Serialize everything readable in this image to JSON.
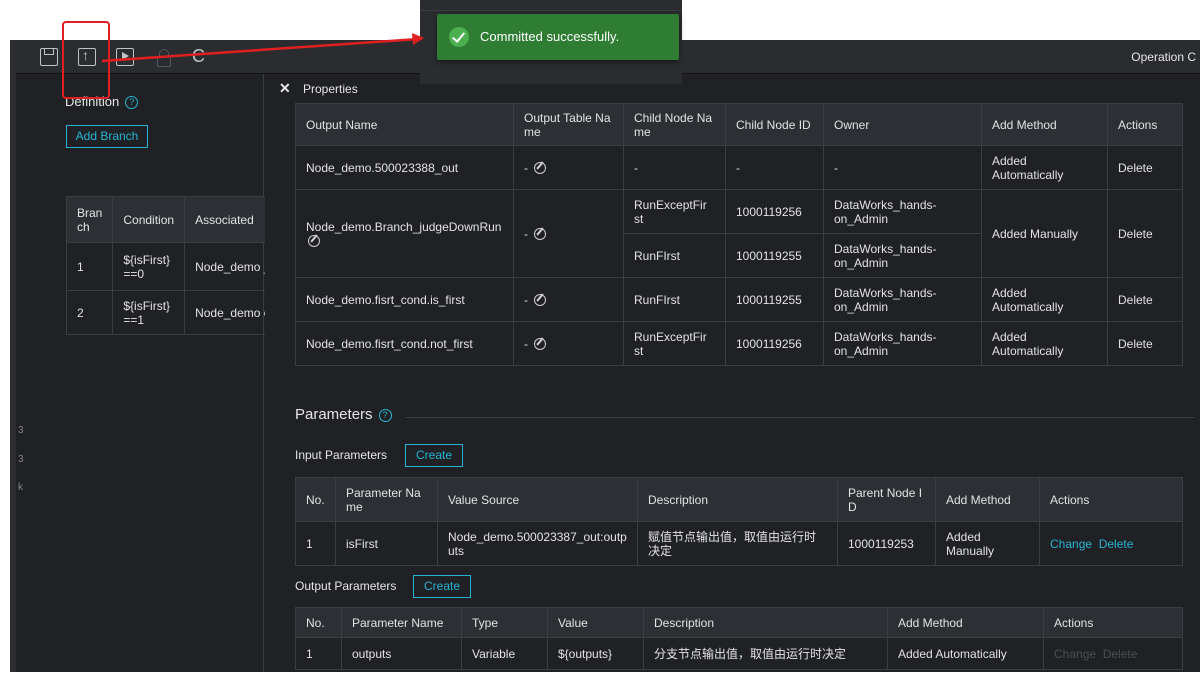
{
  "toolbar": {
    "icons": [
      "save-icon",
      "commit-icon",
      "run-icon",
      "lock-icon",
      "refresh-icon"
    ],
    "right_text": "Operation C"
  },
  "toast": {
    "message": "Committed successfully."
  },
  "definition": {
    "title": "Definition",
    "add_branch_label": "Add Branch",
    "headers": [
      "Bran ch",
      "Condition",
      "Associated"
    ],
    "rows": [
      {
        "branch": "1",
        "condition": "${isFirst} ==0",
        "associated": "Node_demo _first"
      },
      {
        "branch": "2",
        "condition": "${isFirst} ==1",
        "associated": "Node_demo ot_first"
      }
    ]
  },
  "properties": {
    "label": "Properties",
    "headers": [
      "Output Name",
      "Output Table Na me",
      "Child Node Na me",
      "Child Node ID",
      "Owner",
      "Add Method",
      "Actions"
    ],
    "rows": [
      {
        "output_name": "Node_demo.500023388_out",
        "table": "-",
        "child_name": "-",
        "child_id": "-",
        "owner": "-",
        "add_method": "Added Automatically",
        "action": "Delete"
      },
      {
        "output_name": "Node_demo.Branch_judgeDownRun",
        "table": "-",
        "child_name": "RunExceptFir st",
        "child_id": "1000119256",
        "owner": "DataWorks_hands- on_Admin",
        "add_method": "Added Manually",
        "action": "Delete"
      },
      {
        "child_name": "RunFIrst",
        "child_id": "1000119255",
        "owner": "DataWorks_hands- on_Admin"
      },
      {
        "output_name": "Node_demo.fisrt_cond.is_first",
        "table": "-",
        "child_name": "RunFIrst",
        "child_id": "1000119255",
        "owner": "DataWorks_hands- on_Admin",
        "add_method": "Added Automatically",
        "action": "Delete"
      },
      {
        "output_name": "Node_demo.fisrt_cond.not_first",
        "table": "-",
        "child_name": "RunExceptFir st",
        "child_id": "1000119256",
        "owner": "DataWorks_hands- on_Admin",
        "add_method": "Added Automatically",
        "action": "Delete"
      }
    ]
  },
  "parameters": {
    "title": "Parameters",
    "input_label": "Input Parameters",
    "create_label": "Create",
    "input_headers": [
      "No.",
      "Parameter Na me",
      "Value Source",
      "Description",
      "Parent Node I D",
      "Add Method",
      "Actions"
    ],
    "input_row": {
      "no": "1",
      "name": "isFirst",
      "source": "Node_demo.500023387_out:outp uts",
      "description": "赋值节点输出值，取值由运行时 决定",
      "parent_id": "1000119253",
      "add_method": "Added Manually",
      "change": "Change",
      "delete": "Delete"
    },
    "output_label": "Output Parameters",
    "output_headers": [
      "No.",
      "Parameter Name",
      "Type",
      "Value",
      "Description",
      "Add Method",
      "Actions"
    ],
    "output_row": {
      "no": "1",
      "name": "outputs",
      "type": "Variable",
      "value": "${outputs}",
      "description": "分支节点输出值，取值由运行时决定",
      "add_method": "Added Automatically",
      "change": "Change",
      "delete": "Delete"
    }
  },
  "edge": {
    "digits": [
      "3",
      "3",
      "k"
    ]
  },
  "colors": {
    "accent": "#26b5d4",
    "toast_bg": "#2e7d32",
    "annotation": "#e02020"
  }
}
